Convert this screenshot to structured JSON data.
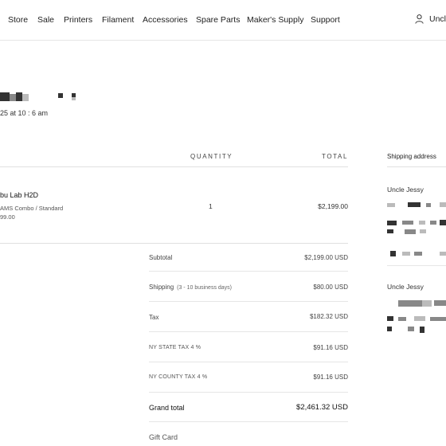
{
  "nav": {
    "items": [
      "Store",
      "Sale",
      "Printers",
      "Filament",
      "Accessories",
      "Spare Parts",
      "Maker's Supply",
      "Support"
    ],
    "account_label": "Uncle"
  },
  "order": {
    "date_text": "25 at 10 : 6 am"
  },
  "table": {
    "col_quantity": "QUANTITY",
    "col_total": "TOTAL"
  },
  "product": {
    "name": "bu Lab H2D",
    "variant": "AMS Combo / Standard",
    "price": "99.00",
    "quantity": "1",
    "total": "$2,199.00"
  },
  "summary": {
    "subtotal_label": "Subtotal",
    "subtotal_value": "$2,199.00 USD",
    "shipping_label": "Shipping",
    "shipping_note": "(3 - 10 business days)",
    "shipping_value": "$80.00 USD",
    "tax_label": "Tax",
    "tax_value": "$182.32 USD",
    "state_tax_label": "NY STATE TAX 4 %",
    "state_tax_value": "$91.16 USD",
    "county_tax_label": "NY COUNTY TAX 4 %",
    "county_tax_value": "$91.16 USD",
    "grand_total_label": "Grand total",
    "grand_total_value": "$2,461.32 USD",
    "gift_card_label": "Gift Card"
  },
  "shipping": {
    "heading": "Shipping address",
    "name": "Uncle Jessy"
  },
  "billing": {
    "name": "Uncle Jessy"
  }
}
